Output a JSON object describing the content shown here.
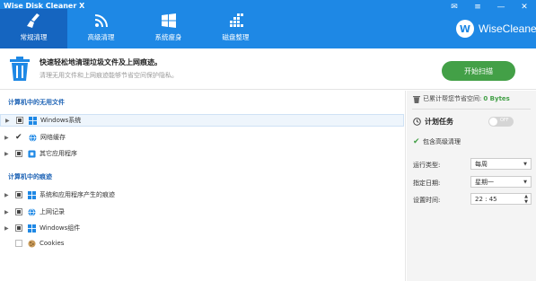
{
  "window": {
    "title": "Wise Disk Cleaner X",
    "controls": {
      "mail": "✉",
      "menu": "≡",
      "minimize": "—",
      "close": "✕"
    }
  },
  "nav": {
    "tabs": [
      {
        "label": "常规清理",
        "icon": "broom-icon",
        "active": true
      },
      {
        "label": "高级清理",
        "icon": "rss-icon",
        "active": false
      },
      {
        "label": "系统瘦身",
        "icon": "windows-icon",
        "active": false
      },
      {
        "label": "磁盘整理",
        "icon": "defrag-icon",
        "active": false
      }
    ],
    "brand": {
      "logo": "W",
      "name": "WiseCleaner"
    }
  },
  "banner": {
    "headline": "快速轻松地清理垃圾文件及上网痕迹。",
    "subline": "清理无用文件和上网痕迹能够节省空间保护隐私。",
    "scan_button": "开始扫描"
  },
  "left": {
    "section1": "计算机中的无用文件",
    "section1_items": [
      {
        "label": "Windows系统",
        "state": "partial",
        "icon": "windows-flag-icon",
        "selected": true
      },
      {
        "label": "网络缓存",
        "state": "checked",
        "icon": "globe-icon",
        "selected": false
      },
      {
        "label": "其它应用程序",
        "state": "partial",
        "icon": "app-icon",
        "selected": false
      }
    ],
    "section2": "计算机中的痕迹",
    "section2_items": [
      {
        "label": "系统和应用程序产生的痕迹",
        "state": "partial",
        "icon": "windows-flag-icon"
      },
      {
        "label": "上网记录",
        "state": "partial",
        "icon": "globe-icon"
      },
      {
        "label": "Windows组件",
        "state": "partial",
        "icon": "windows-flag-icon"
      },
      {
        "label": "Cookies",
        "state": "empty",
        "icon": "cookie-icon"
      }
    ]
  },
  "right": {
    "space_label": "已累计帮您节省空间:",
    "space_value": "0 Bytes",
    "schedule_label": "计划任务",
    "toggle_text": "OFF",
    "include_advanced": "包含高级清理",
    "run_type_label": "运行类型:",
    "run_type_value": "每周",
    "date_label": "指定日期:",
    "date_value": "星期一",
    "time_label": "设置时间:",
    "time_value": "22 : 45"
  },
  "colors": {
    "titlebar": "#1e88e5",
    "active_tab": "#1565c0",
    "scan_button": "#43a047",
    "section_title": "#1e63b5",
    "space_value": "#43a047"
  }
}
